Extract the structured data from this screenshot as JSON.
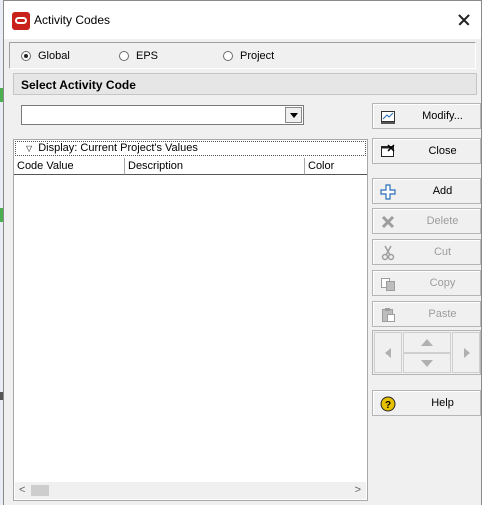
{
  "window": {
    "title": "Activity Codes"
  },
  "scope": {
    "options": [
      {
        "label": "Global",
        "selected": true
      },
      {
        "label": "EPS",
        "selected": false
      },
      {
        "label": "Project",
        "selected": false
      }
    ]
  },
  "section": {
    "title": "Select Activity Code"
  },
  "code_select": {
    "value": ""
  },
  "grid": {
    "display_label": "Display: Current Project's Values",
    "columns": [
      "Code Value",
      "Description",
      "Color"
    ],
    "rows": []
  },
  "buttons": {
    "modify": "Modify...",
    "close": "Close",
    "add": "Add",
    "delete": "Delete",
    "cut": "Cut",
    "copy": "Copy",
    "paste": "Paste",
    "help": "Help"
  },
  "colors": {
    "accent": "#c8221b",
    "add_icon": "#2a6db5",
    "help_icon": "#e5c100"
  }
}
